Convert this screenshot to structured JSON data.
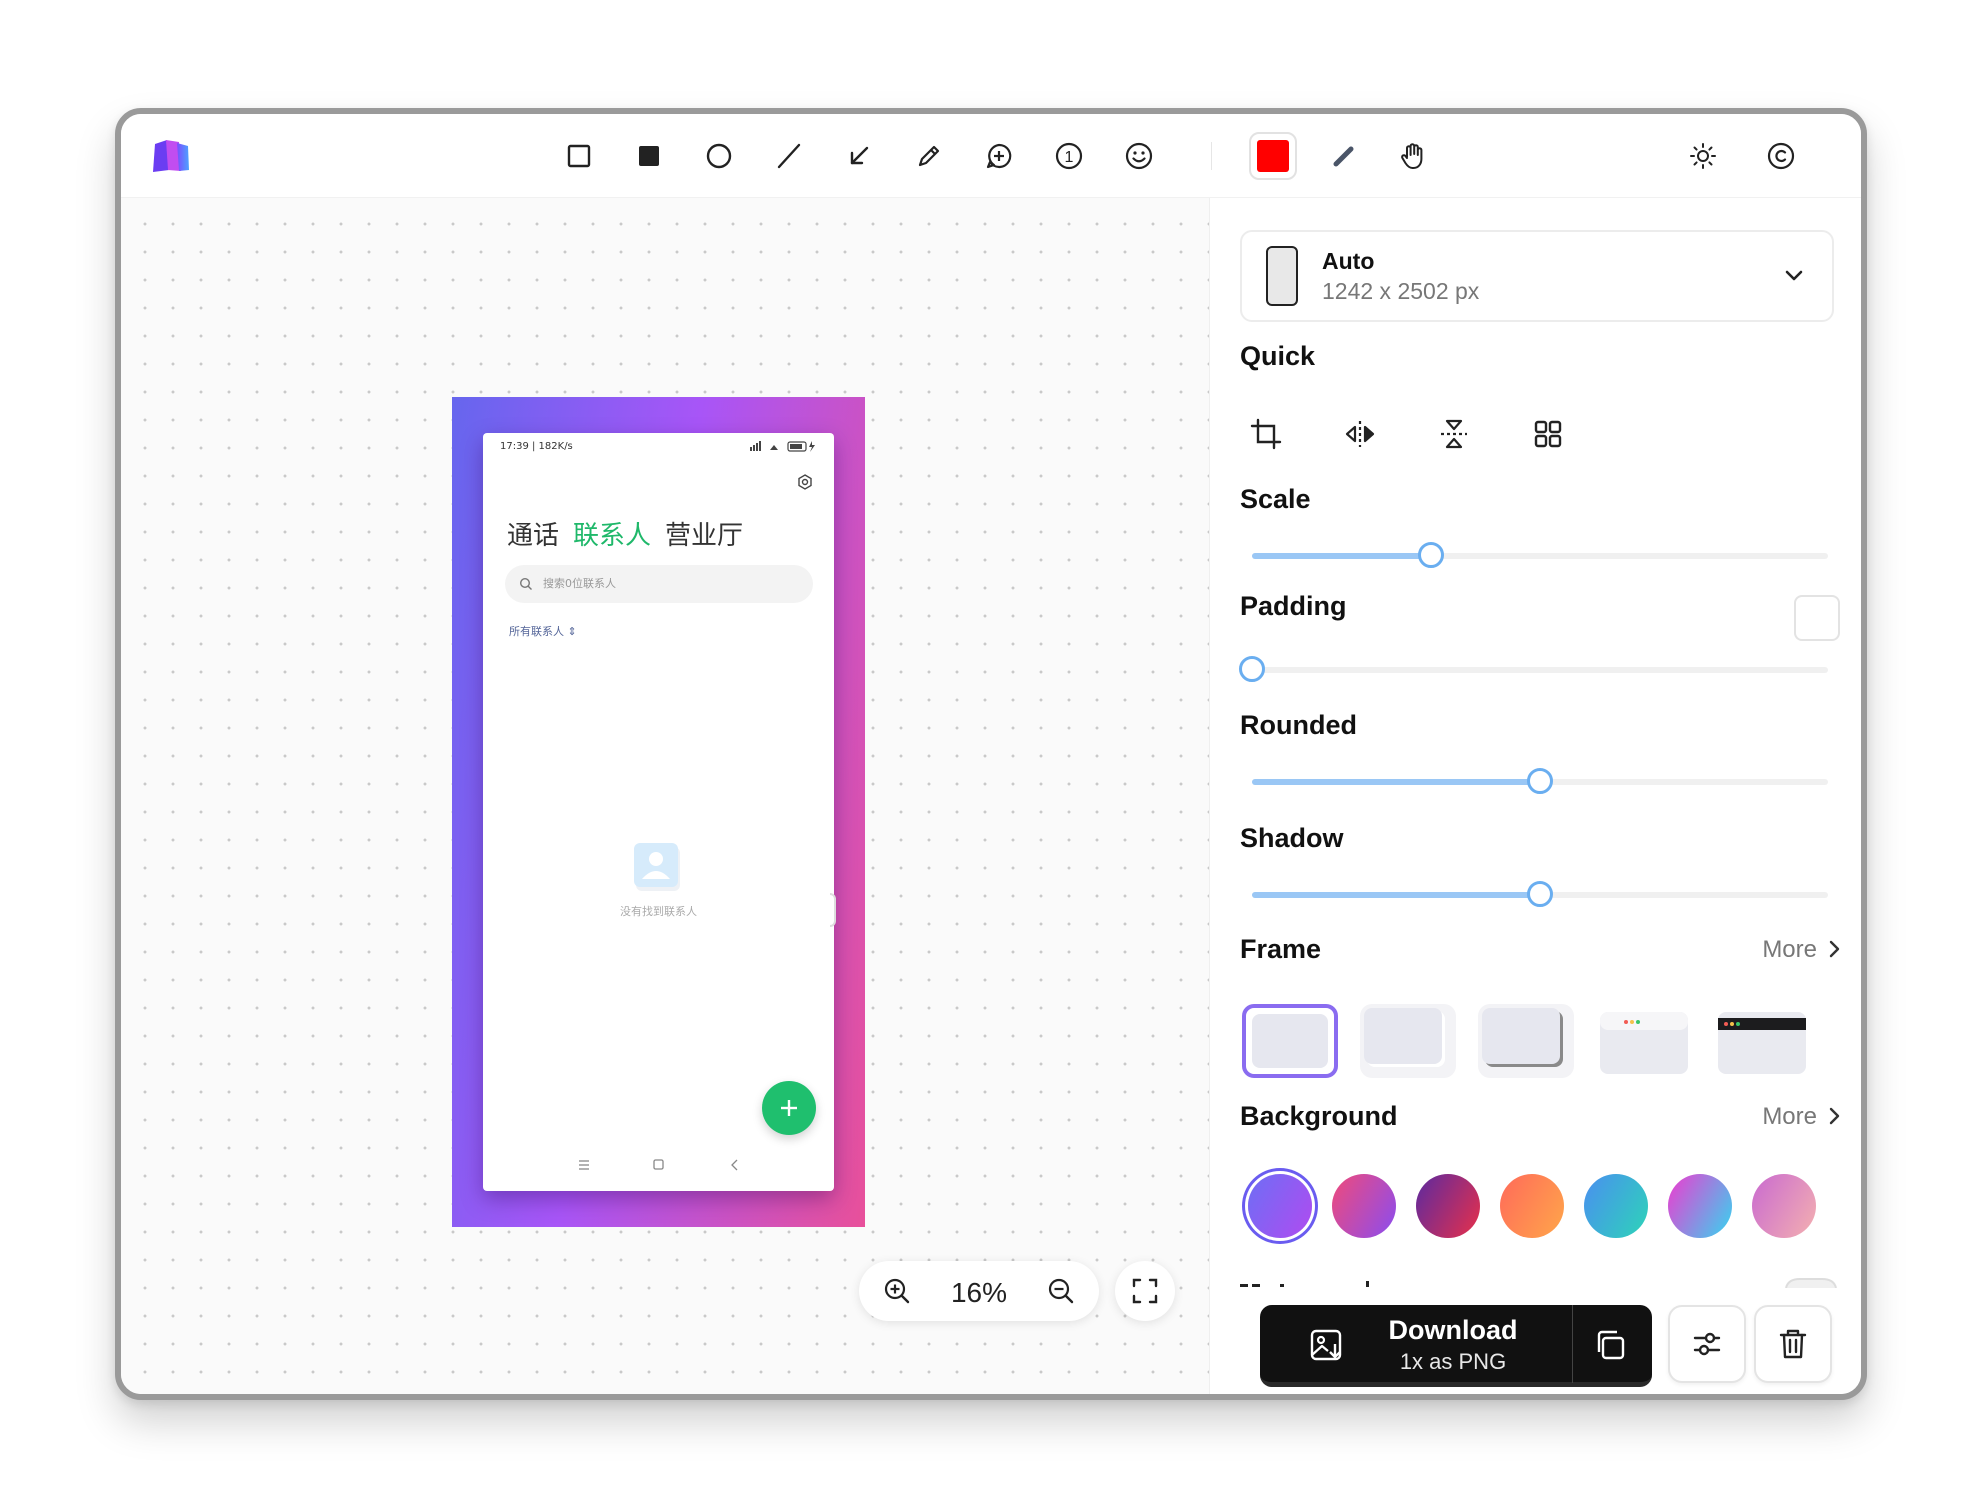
{
  "toolbar": {
    "tools": [
      "rectangle-icon",
      "filled-rectangle-icon",
      "ellipse-icon",
      "line-icon",
      "arrow-icon",
      "pencil-icon",
      "comment-icon",
      "step-number-icon",
      "emoji-icon"
    ],
    "current_color": "#ff0000",
    "step_number": "1"
  },
  "canvas": {
    "zoom": "16%",
    "screenshot": {
      "status_time": "17:39 | 182K/s",
      "tabs": [
        "通话",
        "联系人",
        "营业厅"
      ],
      "active_tab": 1,
      "search_placeholder": "搜索0位联系人",
      "filter": "所有联系人",
      "empty_text": "没有找到联系人"
    }
  },
  "panel": {
    "size": {
      "name": "Auto",
      "dimensions": "1242 x 2502 px"
    },
    "quick_title": "Quick",
    "scale": {
      "title": "Scale",
      "value": 0.31
    },
    "padding": {
      "title": "Padding",
      "value": 0.0
    },
    "rounded": {
      "title": "Rounded",
      "value": 0.5
    },
    "shadow": {
      "title": "Shadow",
      "value": 0.5
    },
    "frame": {
      "title": "Frame",
      "more": "More",
      "selected": 0
    },
    "background": {
      "title": "Background",
      "more": "More",
      "selected": 0,
      "swatches": [
        [
          "#6e6ef5",
          "#b04bf0"
        ],
        [
          "#f04a7a",
          "#8a4df0"
        ],
        [
          "#5b2aa0",
          "#e8304a"
        ],
        [
          "#ff6a5a",
          "#ffa64a"
        ],
        [
          "#4a8ff0",
          "#2dd4b8"
        ],
        [
          "#f03ad0",
          "#34d6f0"
        ],
        [
          "#c96ad0",
          "#f4b0b0"
        ]
      ]
    },
    "download": {
      "title": "Download",
      "subtitle": "1x as PNG"
    }
  }
}
